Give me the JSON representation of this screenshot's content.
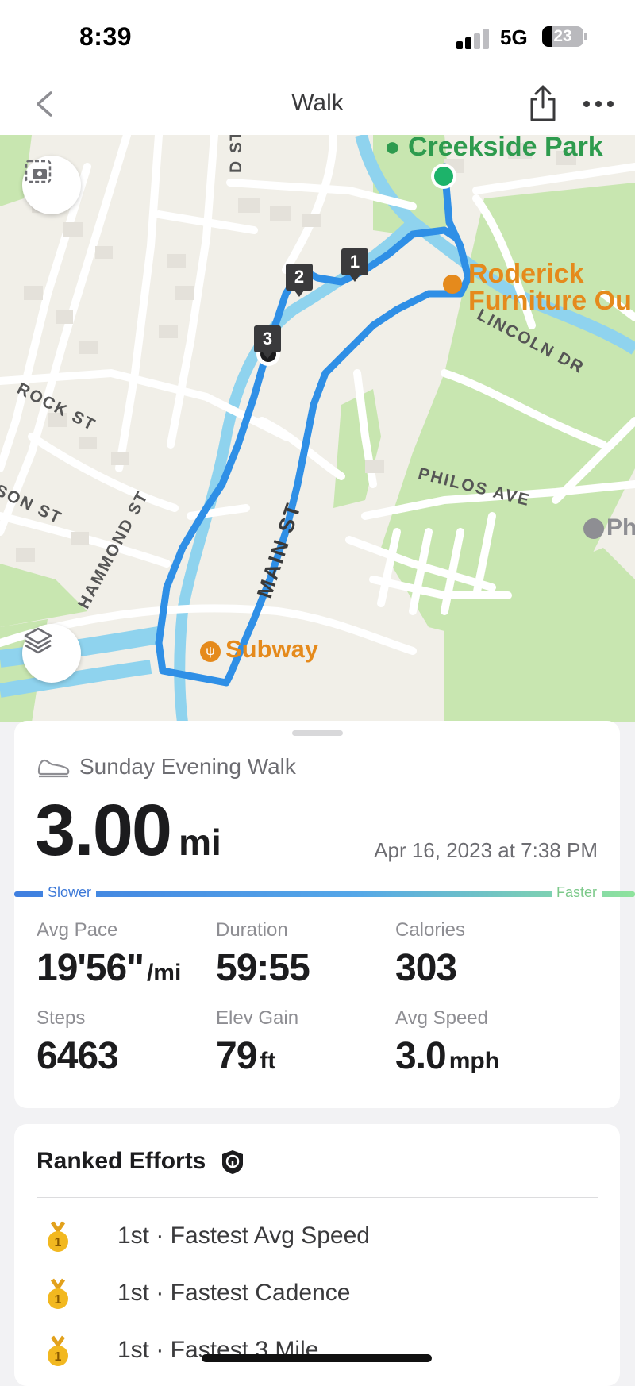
{
  "status": {
    "time": "8:39",
    "network": "5G",
    "battery": "23",
    "battery_level": 0.23
  },
  "nav": {
    "title": "Walk"
  },
  "map": {
    "pois": {
      "park": "Creekside Park",
      "furniture_1": "Roderick",
      "furniture_2": "Furniture Ou",
      "subway": "Subway",
      "ph": "Ph"
    },
    "streets": {
      "main": "MAIN ST",
      "lincoln": "LINCOLN DR",
      "philos": "PHILOS AVE",
      "rock": "ROCK ST",
      "hammond": "HAMMOND ST",
      "son": "SON ST",
      "d_st": "D ST"
    },
    "markers": [
      "1",
      "2",
      "3"
    ]
  },
  "summary": {
    "activity_name": "Sunday Evening Walk",
    "distance": "3.00",
    "distance_unit": "mi",
    "date": "Apr 16, 2023 at 7:38 PM",
    "pace_scale": {
      "slower": "Slower",
      "faster": "Faster"
    },
    "stats": [
      {
        "label": "Avg Pace",
        "value": "19'56\"",
        "unit": "/mi"
      },
      {
        "label": "Duration",
        "value": "59:55",
        "unit": ""
      },
      {
        "label": "Calories",
        "value": "303",
        "unit": ""
      },
      {
        "label": "Steps",
        "value": "6463",
        "unit": ""
      },
      {
        "label": "Elev Gain",
        "value": "79",
        "unit": "ft"
      },
      {
        "label": "Avg Speed",
        "value": "3.0",
        "unit": "mph"
      }
    ]
  },
  "ranked": {
    "title": "Ranked Efforts",
    "items": [
      {
        "medal": "1",
        "text": "1st · Fastest Avg Speed"
      },
      {
        "medal": "1",
        "text": "1st · Fastest Cadence"
      },
      {
        "medal": "1",
        "text": "1st · Fastest 3 Mile"
      }
    ]
  },
  "colors": {
    "route": "#2f8fe6",
    "park_green": "#c8e6b0",
    "water": "#8fd3ee",
    "accent_orange": "#e58a1c",
    "start_dot": "#1db36a"
  }
}
